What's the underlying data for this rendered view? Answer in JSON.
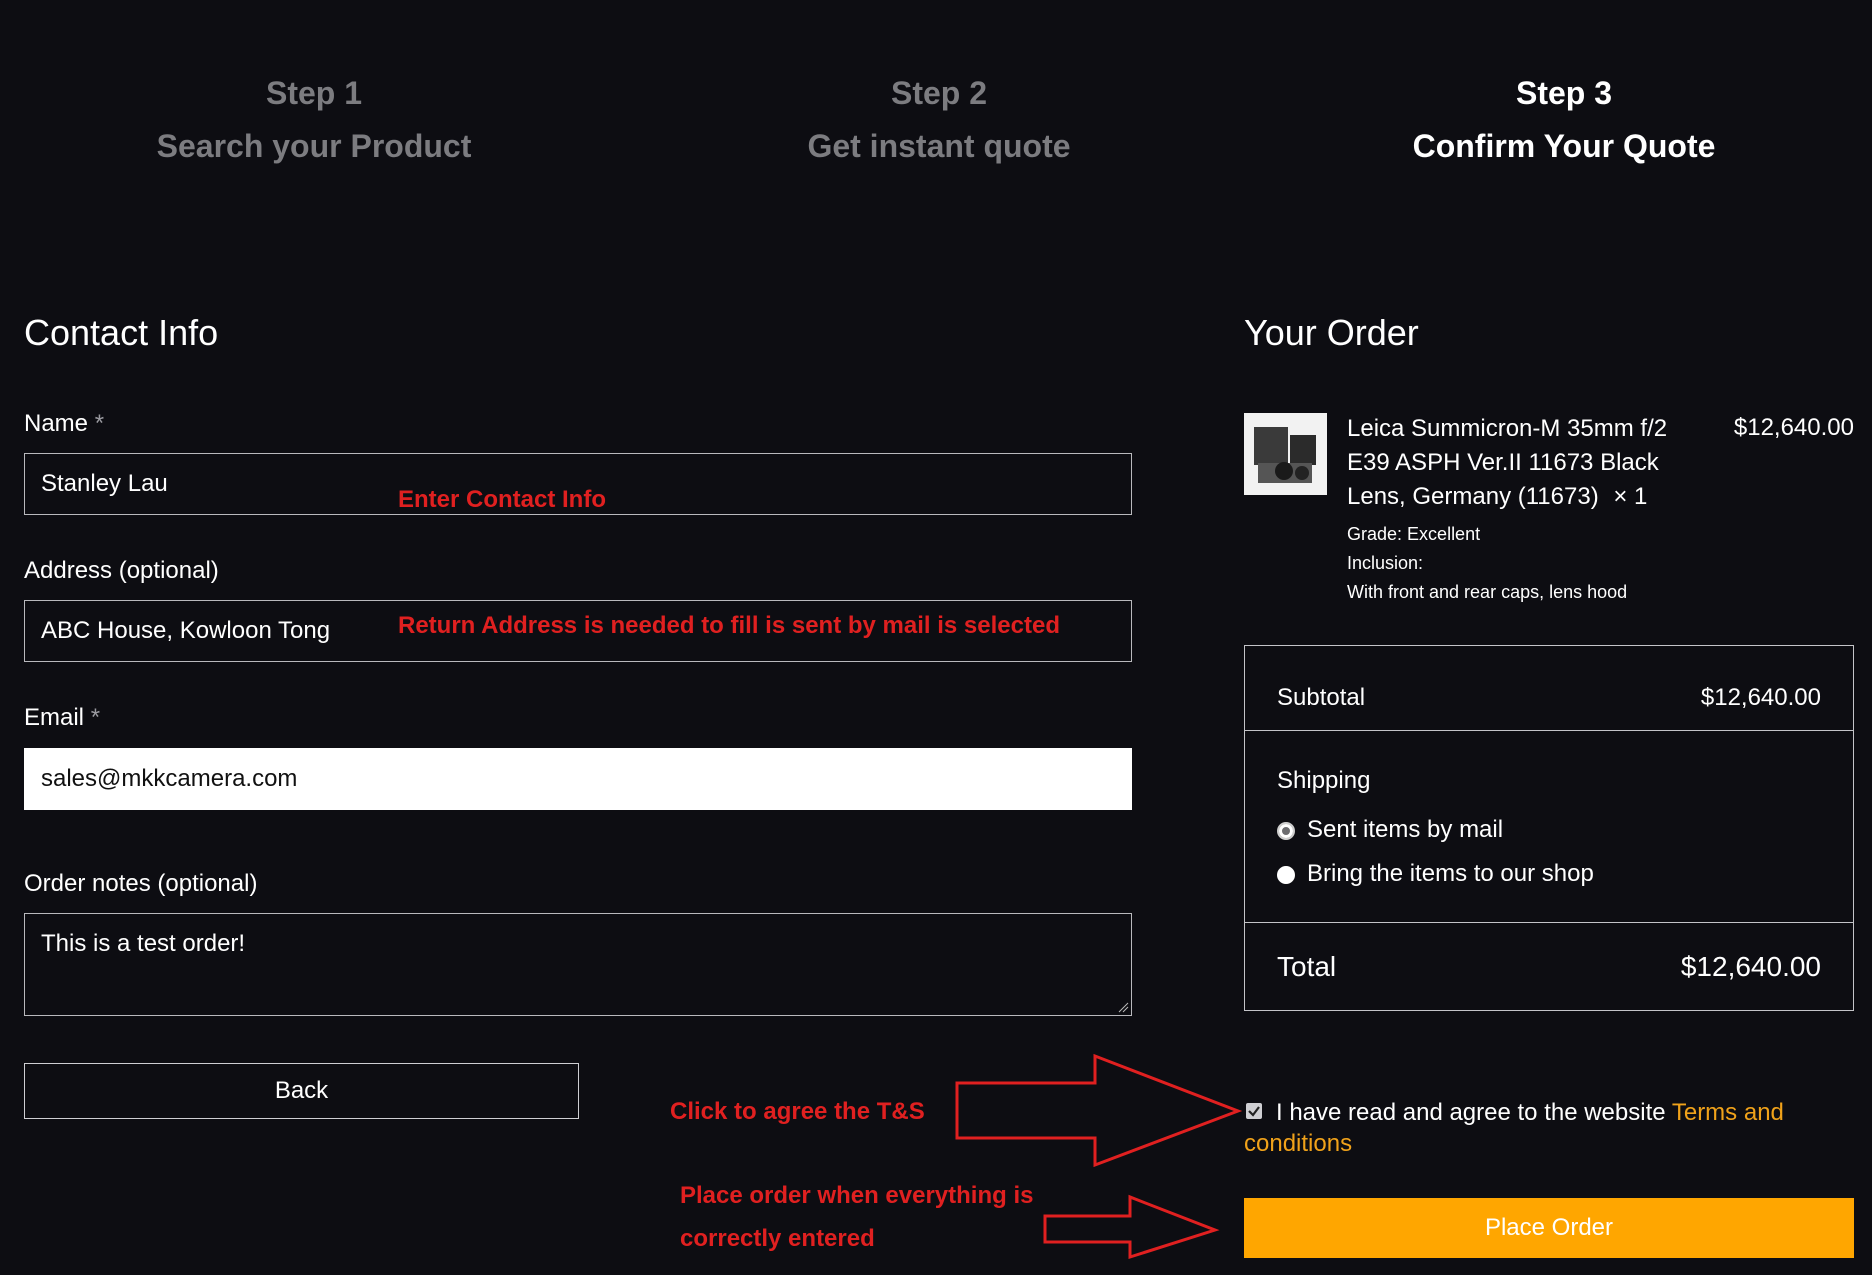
{
  "steps": [
    {
      "num": "Step 1",
      "title": "Search your Product"
    },
    {
      "num": "Step 2",
      "title": "Get instant quote"
    },
    {
      "num": "Step 3",
      "title": "Confirm Your Quote"
    }
  ],
  "contact": {
    "heading": "Contact Info",
    "name_label": "Name",
    "name_value": "Stanley Lau",
    "address_label": "Address (optional)",
    "address_value": "ABC House, Kowloon Tong",
    "email_label": "Email",
    "email_value": "sales@mkkcamera.com",
    "notes_label": "Order notes (optional)",
    "notes_value": "This is a test order!",
    "required_mark": "*",
    "back_label": "Back"
  },
  "annotations": {
    "contact": "Enter Contact Info",
    "address": "Return Address is needed to fill is sent by mail is selected",
    "agree": "Click to agree the T&S",
    "place_line1": "Place order when everything is",
    "place_line2": "correctly entered",
    "color": "#e02020"
  },
  "order": {
    "heading": "Your Order",
    "product_title": "Leica Summicron-M 35mm f/2 E39 ASPH Ver.II 11673 Black Lens, Germany (11673)",
    "quantity": "× 1",
    "price": "$12,640.00",
    "grade_label": "Grade:",
    "grade_value": "Excellent",
    "inclusion_label": "Inclusion:",
    "inclusion_value": "With front and rear caps, lens hood",
    "subtotal_label": "Subtotal",
    "subtotal_value": "$12,640.00",
    "shipping_label": "Shipping",
    "shipping_options": [
      "Sent items by mail",
      "Bring the items to our shop"
    ],
    "shipping_selected": "Sent items by mail",
    "total_label": "Total",
    "total_value": "$12,640.00",
    "agree_text": "I have read and agree to the website",
    "terms_link": "Terms and",
    "terms_link2": "conditions",
    "agree_checked": true,
    "place_order_label": "Place Order",
    "accent_color": "#ffa600",
    "link_color": "#f0a21a"
  }
}
